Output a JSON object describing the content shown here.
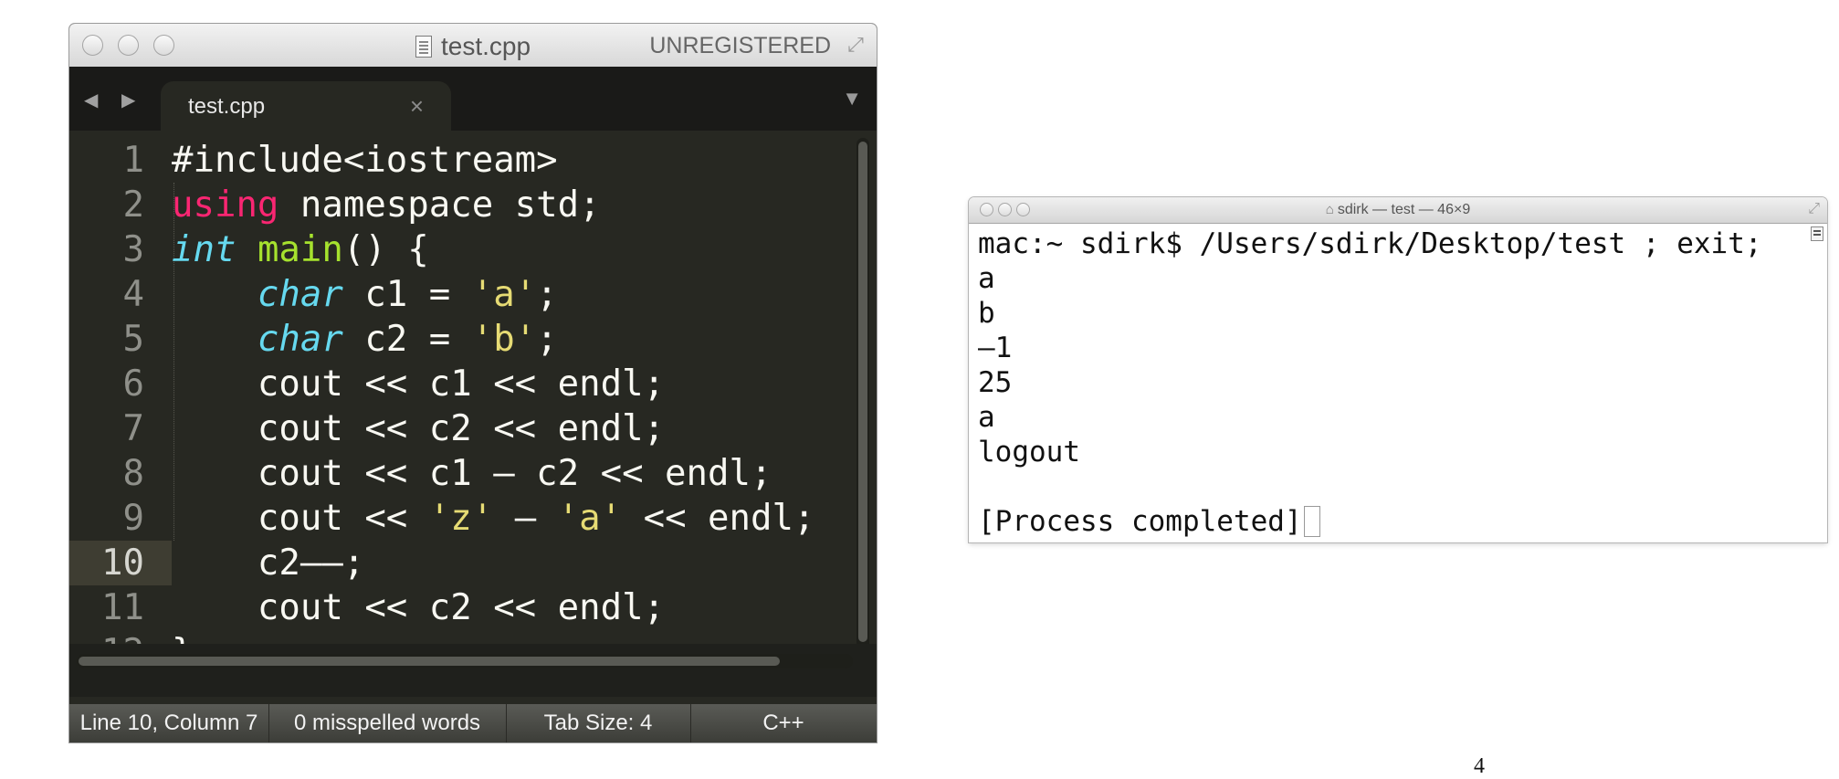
{
  "editor": {
    "title": "test.cpp",
    "registration": "UNREGISTERED",
    "tab_label": "test.cpp",
    "tab_close": "×",
    "nav_arrows": "◀ ▶",
    "tab_menu": "▼",
    "active_line": 10,
    "lines": [
      [
        {
          "t": "#include<iostream>",
          "c": "plain"
        }
      ],
      [
        {
          "t": "using",
          "c": "keyword"
        },
        {
          "t": " namespace std;",
          "c": "plain"
        }
      ],
      [
        {
          "t": "int",
          "c": "type"
        },
        {
          "t": " ",
          "c": "plain"
        },
        {
          "t": "main",
          "c": "function"
        },
        {
          "t": "() {",
          "c": "plain"
        }
      ],
      [
        {
          "t": "    ",
          "c": "plain"
        },
        {
          "t": "char",
          "c": "type"
        },
        {
          "t": " c1 = ",
          "c": "plain"
        },
        {
          "t": "'a'",
          "c": "string"
        },
        {
          "t": ";",
          "c": "plain"
        }
      ],
      [
        {
          "t": "    ",
          "c": "plain"
        },
        {
          "t": "char",
          "c": "type"
        },
        {
          "t": " c2 = ",
          "c": "plain"
        },
        {
          "t": "'b'",
          "c": "string"
        },
        {
          "t": ";",
          "c": "plain"
        }
      ],
      [
        {
          "t": "    cout << c1 << endl;",
          "c": "plain"
        }
      ],
      [
        {
          "t": "    cout << c2 << endl;",
          "c": "plain"
        }
      ],
      [
        {
          "t": "    cout << c1 – c2 << endl;",
          "c": "plain"
        }
      ],
      [
        {
          "t": "    cout << ",
          "c": "plain"
        },
        {
          "t": "'z'",
          "c": "string"
        },
        {
          "t": " – ",
          "c": "plain"
        },
        {
          "t": "'a'",
          "c": "string"
        },
        {
          "t": " << endl;",
          "c": "plain"
        }
      ],
      [
        {
          "t": "    c2––;",
          "c": "plain"
        }
      ],
      [
        {
          "t": "    cout << c2 << endl;",
          "c": "plain"
        }
      ],
      [
        {
          "t": "}",
          "c": "plain"
        }
      ]
    ],
    "status": {
      "position": "Line 10, Column 7",
      "spelling": "0 misspelled words",
      "tab_size": "Tab Size: 4",
      "syntax": "C++"
    }
  },
  "terminal": {
    "title": "sdirk — test — 46×9",
    "lines": [
      "mac:~ sdirk$ /Users/sdirk/Desktop/test ; exit;",
      "a",
      "b",
      "–1",
      "25",
      "a",
      "logout",
      "",
      "[Process completed]"
    ]
  },
  "page_number": "4",
  "colors": {
    "editor_bg": "#272822",
    "keyword": "#f92672",
    "type": "#66d9ef",
    "function": "#a6e22e",
    "string": "#e6db74",
    "plain": "#f8f8f2"
  }
}
